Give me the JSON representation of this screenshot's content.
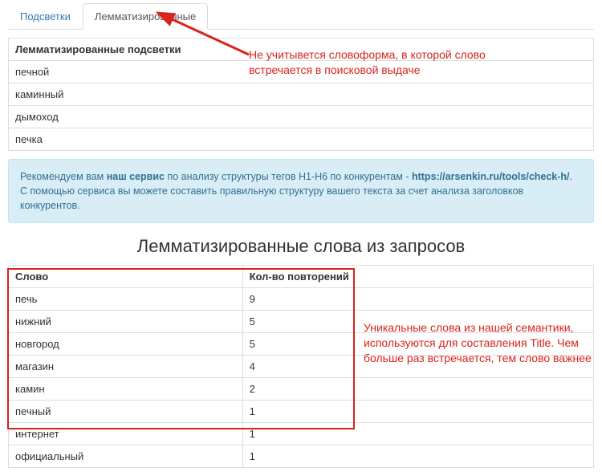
{
  "tabs": {
    "items": [
      {
        "label": "Подсветки",
        "active": false
      },
      {
        "label": "Лемматизированные",
        "active": true
      }
    ]
  },
  "table1": {
    "header": "Лемматизированные подсветки",
    "rows": [
      "печной",
      "каминный",
      "дымоход",
      "печка"
    ]
  },
  "notice": {
    "pre": "Рекомендуем вам ",
    "strong1": "наш сервис",
    "mid": " по анализу структуры тегов H1-H6 по конкурентам - ",
    "link": "https://arsenkin.ru/tools/check-h/",
    "post": ". С помощью сервиса вы можете составить правильную структуру вашего текста за счет анализа заголовков конкурентов."
  },
  "section_title": "Лемматизированные слова из запросов",
  "table2": {
    "col1": "Слово",
    "col2": "Кол-во повторений",
    "rows": [
      {
        "word": "печь",
        "count": "9"
      },
      {
        "word": "нижний",
        "count": "5"
      },
      {
        "word": "новгород",
        "count": "5"
      },
      {
        "word": "магазин",
        "count": "4"
      },
      {
        "word": "камин",
        "count": "2"
      },
      {
        "word": "печный",
        "count": "1"
      },
      {
        "word": "интернет",
        "count": "1"
      },
      {
        "word": "официальный",
        "count": "1"
      }
    ]
  },
  "annotations": {
    "top": "Не учитывется словоформа, в которой слово встречается в поисковой выдаче",
    "bottom": "Уникальные слова из нашей семантики, используются для составления Title. Чем больше раз встречается, тем слово важнее"
  }
}
